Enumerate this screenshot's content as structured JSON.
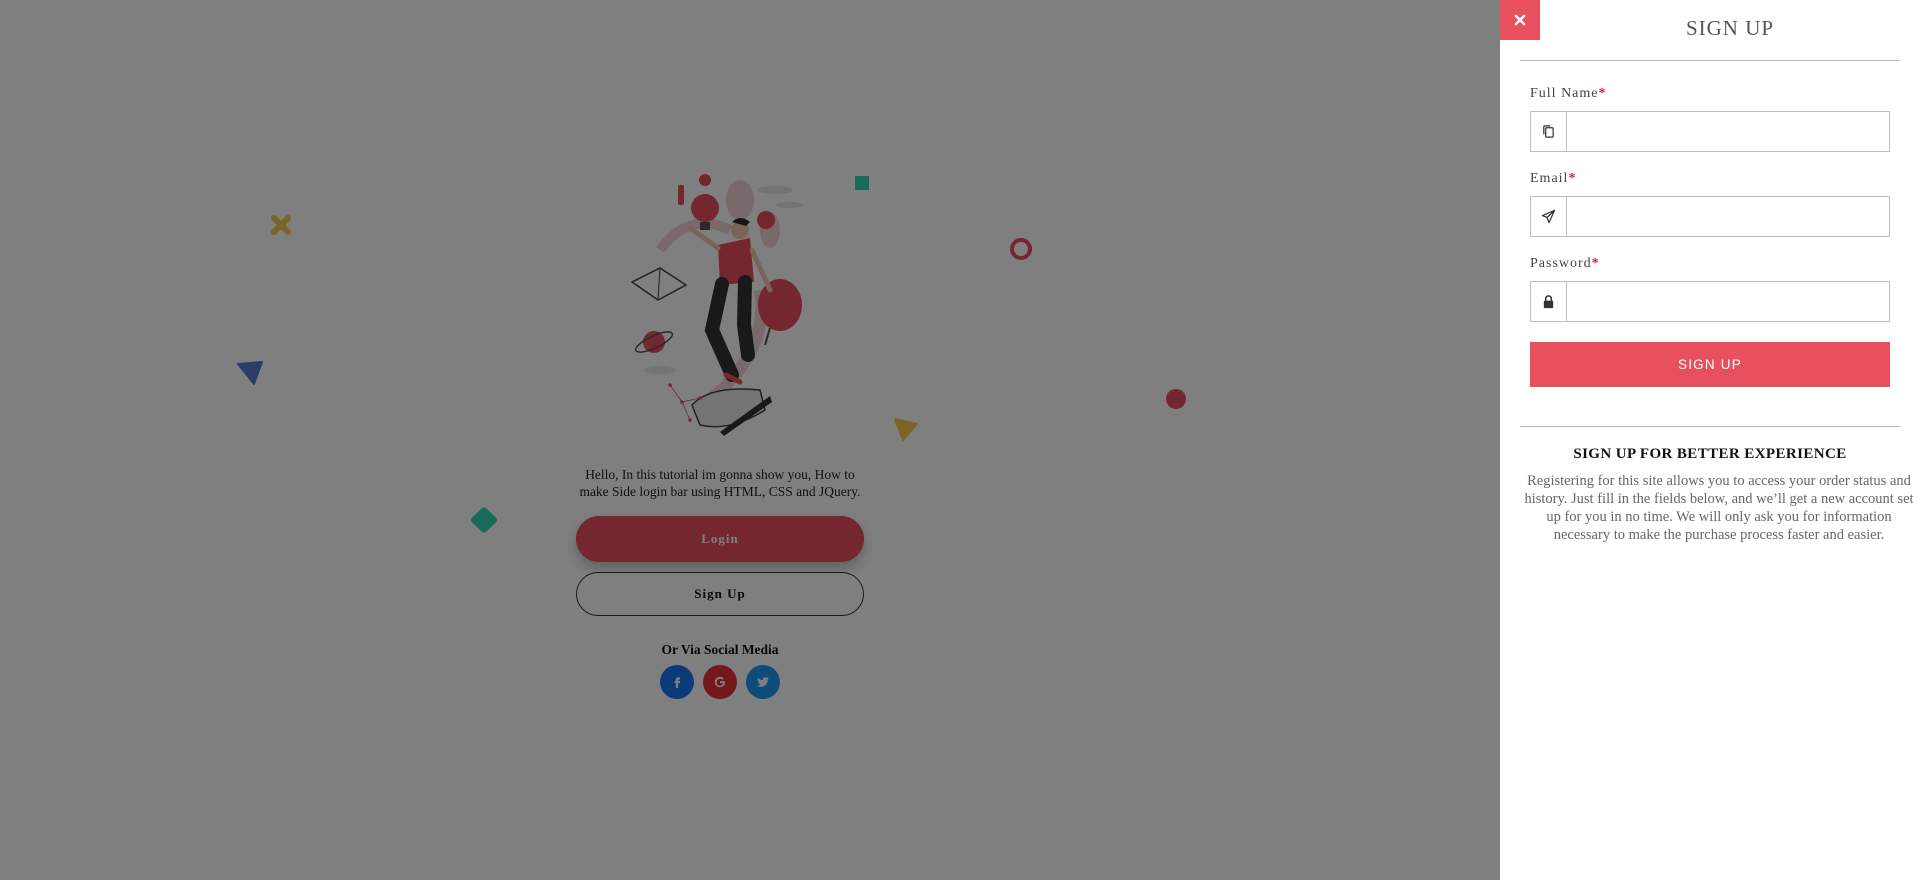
{
  "colors": {
    "accent": "#e84f5f",
    "facebook": "#1877f2",
    "google": "#e8303a",
    "twitter": "#1d9bf0",
    "required_star": "#e21b2f"
  },
  "main": {
    "intro_text": "Hello, In this tutorial im gonna show you, How to make Side login bar using HTML, CSS and JQuery.",
    "login_button": "Login",
    "signup_button": "Sign Up",
    "social_title": "Or Via Social Media",
    "social_icons": [
      "facebook-icon",
      "google-icon",
      "twitter-icon"
    ]
  },
  "panel": {
    "close_icon": "close-icon",
    "title": "SIGN UP",
    "fields": [
      {
        "label": "Full Name",
        "required_mark": "*",
        "icon": "copy-icon",
        "value": "",
        "placeholder": ""
      },
      {
        "label": "Email",
        "required_mark": "*",
        "icon": "paper-plane-icon",
        "value": "",
        "placeholder": ""
      },
      {
        "label": "Password",
        "required_mark": "*",
        "icon": "lock-icon",
        "value": "",
        "placeholder": ""
      }
    ],
    "submit_label": "SIGN UP",
    "info_title": "SIGN UP FOR BETTER EXPERIENCE",
    "info_text": "Registering for this site allows you to access your order status and history. Just fill in the fields below, and we’ll get a new account set up for you in no time. We will only ask you for information necessary to make the purchase process faster and easier."
  }
}
